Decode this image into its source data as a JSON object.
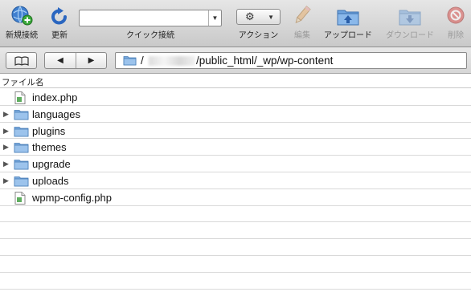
{
  "toolbar": {
    "new_connection": {
      "label": "新規接続",
      "icon": "globe-plus-icon"
    },
    "refresh": {
      "label": "更新",
      "icon": "refresh-arrow-icon"
    },
    "quick_connect": {
      "label": "クイック接続",
      "value": ""
    },
    "action": {
      "label": "アクション",
      "icon": "gear-icon"
    },
    "edit": {
      "label": "編集",
      "icon": "pencil-icon",
      "enabled": false
    },
    "upload": {
      "label": "アップロード",
      "icon": "upload-folder-icon"
    },
    "download": {
      "label": "ダウンロード",
      "icon": "download-folder-icon",
      "enabled": false
    },
    "delete": {
      "label": "削除",
      "icon": "delete-icon",
      "enabled": false
    }
  },
  "navigation": {
    "bookmarks_glyph": "📖",
    "back_glyph": "◀",
    "forward_glyph": "▶",
    "path": "/public_html/_wp/wp-content",
    "path_prefix": "/"
  },
  "browser": {
    "column_header": "ファイル名",
    "items": [
      {
        "name": "index.php",
        "type": "file"
      },
      {
        "name": "languages",
        "type": "folder"
      },
      {
        "name": "plugins",
        "type": "folder"
      },
      {
        "name": "themes",
        "type": "folder"
      },
      {
        "name": "upgrade",
        "type": "folder"
      },
      {
        "name": "uploads",
        "type": "folder"
      },
      {
        "name": "wpmp-config.php",
        "type": "file"
      }
    ]
  },
  "colors": {
    "folder_blue": "#8fb6e0",
    "toolbar_top": "#e6e6e6",
    "toolbar_bottom": "#c9c9c9",
    "delete_red": "#d9534f"
  }
}
